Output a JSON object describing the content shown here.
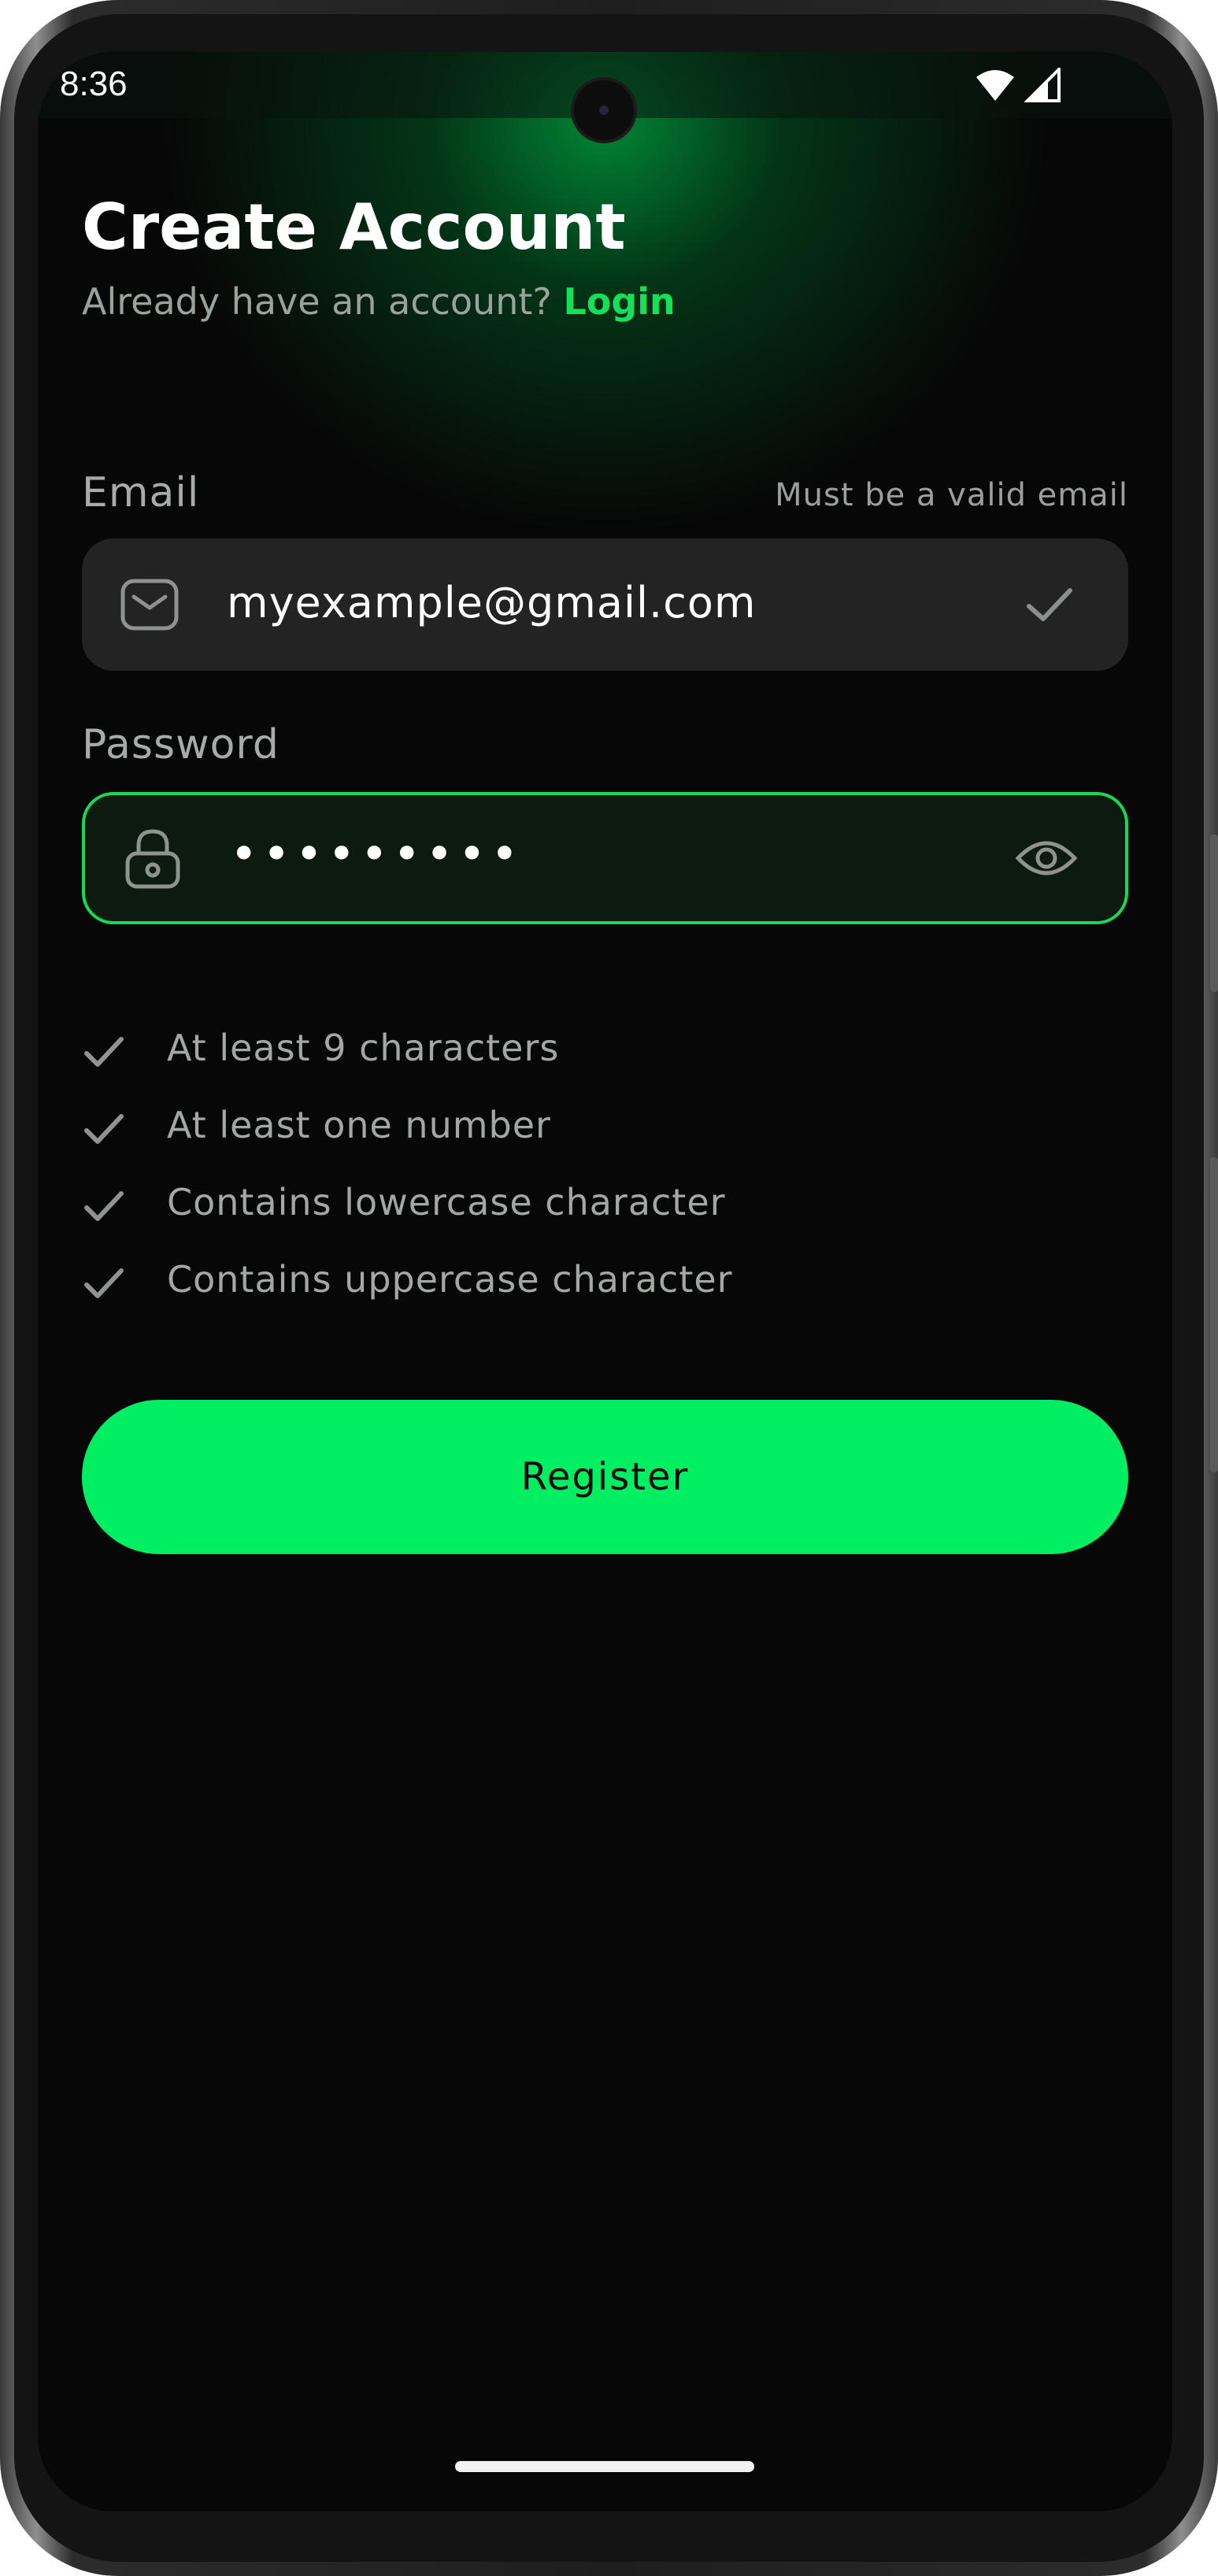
{
  "status_bar": {
    "time": "8:36"
  },
  "header": {
    "title": "Create Account",
    "subtitle_text": "Already have an account?",
    "login_link": "Login"
  },
  "email": {
    "label": "Email",
    "hint": "Must be a valid email",
    "value": "myexample@gmail.com",
    "icon": "envelope-icon",
    "valid_icon": "checkmark-icon"
  },
  "password": {
    "label": "Password",
    "value": "•••••••••",
    "icon": "lock-icon",
    "toggle_icon": "eye-icon"
  },
  "requirements": [
    {
      "label": "At least 9 characters",
      "met": true
    },
    {
      "label": "At least one number",
      "met": true
    },
    {
      "label": "Contains lowercase character",
      "met": true
    },
    {
      "label": "Contains uppercase character",
      "met": true
    }
  ],
  "register_button": "Register",
  "colors": {
    "accent": "#00EF62",
    "link": "#14E05A",
    "background": "#070707",
    "field_bg": "#222322"
  }
}
